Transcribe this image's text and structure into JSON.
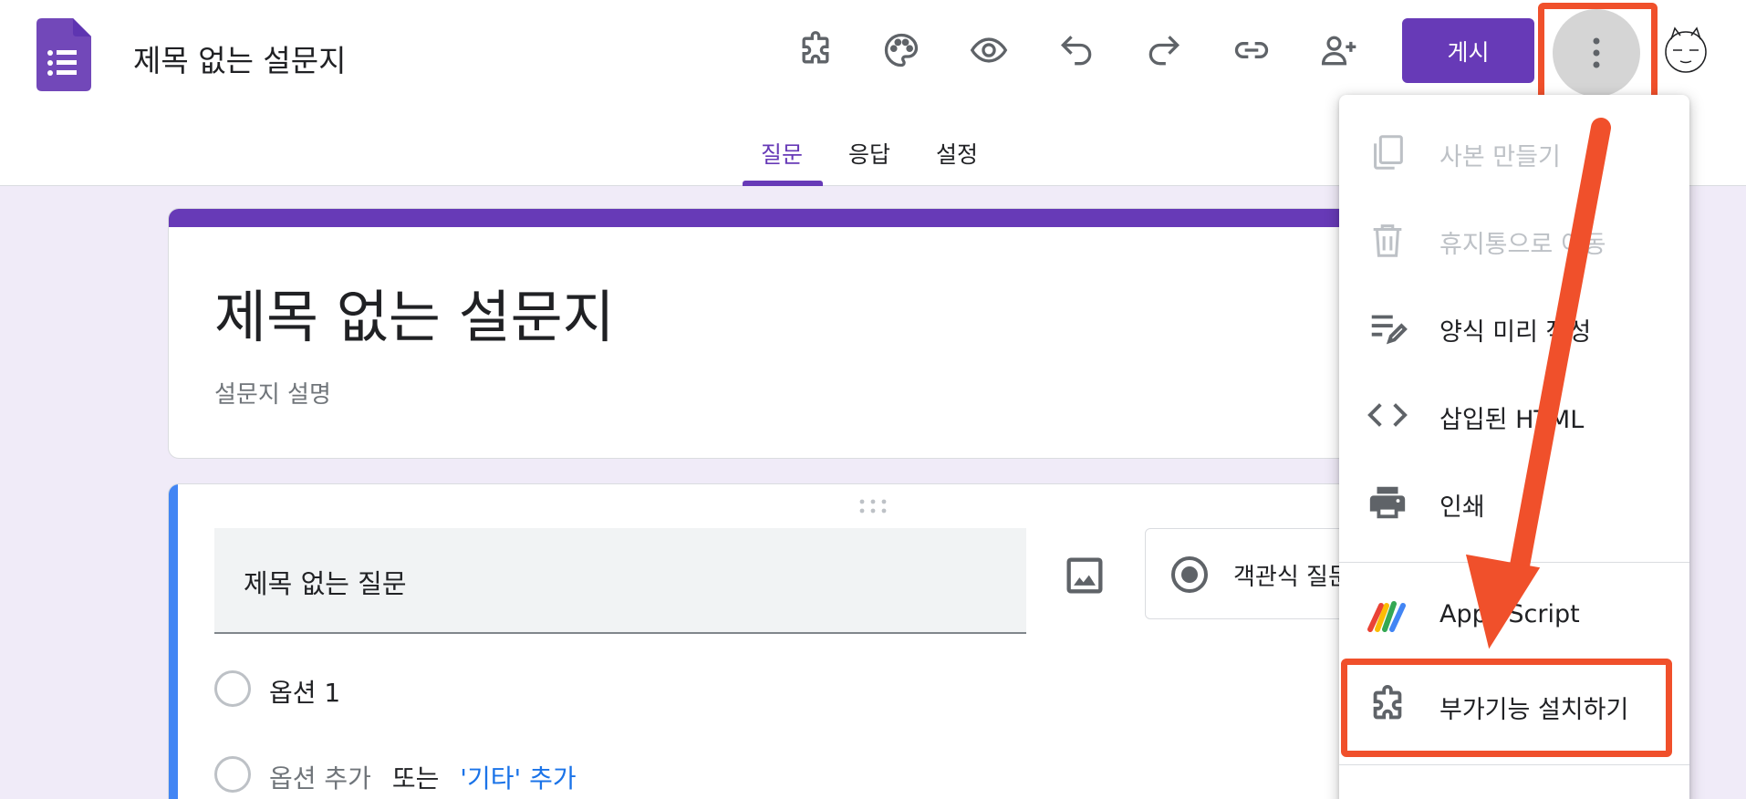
{
  "app": {
    "doc_title": "제목 없는 설문지",
    "publish_label": "게시"
  },
  "toolbar": {
    "icons": [
      "addon-icon",
      "palette-icon",
      "preview-eye-icon",
      "undo-icon",
      "redo-icon",
      "link-icon",
      "add-collaborator-icon"
    ]
  },
  "tabs": [
    {
      "label": "질문",
      "active": true
    },
    {
      "label": "응답",
      "active": false
    },
    {
      "label": "설정",
      "active": false
    }
  ],
  "form": {
    "title": "제목 없는 설문지",
    "description_placeholder": "설문지 설명"
  },
  "question": {
    "title": "제목 없는 질문",
    "type_label": "객관식 질문",
    "option_1": "옵션 1",
    "add_option": "옵션 추가",
    "or_text": "또는",
    "add_other": "'기타' 추가"
  },
  "menu": {
    "items": [
      {
        "label": "사본 만들기",
        "icon": "copy-icon",
        "disabled": true
      },
      {
        "label": "휴지통으로 이동",
        "icon": "trash-icon",
        "disabled": true
      },
      {
        "label": "양식 미리 작성",
        "icon": "prefill-icon",
        "disabled": false
      },
      {
        "label": "삽입된 HTML",
        "icon": "code-icon",
        "disabled": false
      },
      {
        "label": "인쇄",
        "icon": "print-icon",
        "disabled": false
      },
      {
        "label": "Apps Script",
        "icon": "apps-script-icon",
        "disabled": false
      },
      {
        "label": "부가기능 설치하기",
        "icon": "addon-puzzle-icon",
        "disabled": false
      }
    ]
  },
  "colors": {
    "brand_purple": "#673ab7",
    "annotation_red": "#f0502b",
    "question_accent_blue": "#4285f4",
    "link_blue": "#1a73e8",
    "page_background": "#f0ebf8"
  }
}
